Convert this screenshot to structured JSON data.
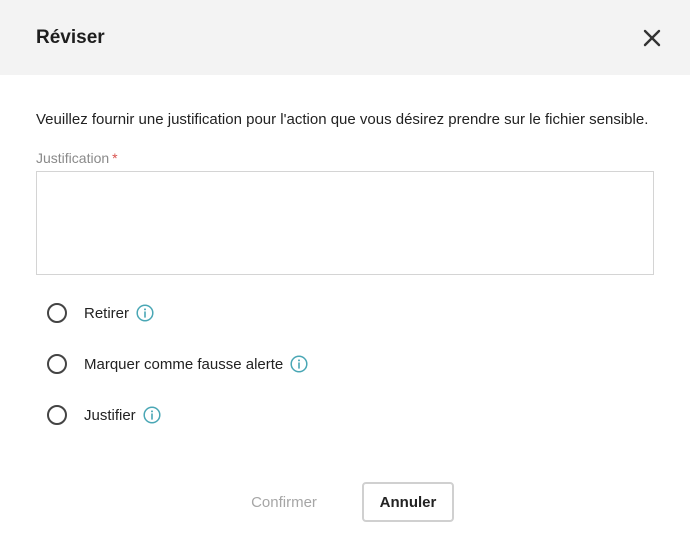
{
  "dialog": {
    "title": "Réviser",
    "close_icon": "close-icon",
    "description": "Veuillez fournir une justification pour l'action que vous désirez prendre sur le fichier sensible.",
    "field": {
      "label": "Justification",
      "required_mark": "*",
      "value": ""
    },
    "options": [
      {
        "label": "Retirer",
        "icon": "info-icon"
      },
      {
        "label": "Marquer comme fausse alerte",
        "icon": "info-icon"
      },
      {
        "label": "Justifier",
        "icon": "info-icon"
      }
    ],
    "buttons": {
      "confirm_label": "Confirmer",
      "cancel_label": "Annuler"
    },
    "colors": {
      "header_bg": "#f3f3f3",
      "info_icon": "#4aa7b5",
      "required": "#d9534f",
      "disabled_text": "#a6a6a6"
    }
  }
}
